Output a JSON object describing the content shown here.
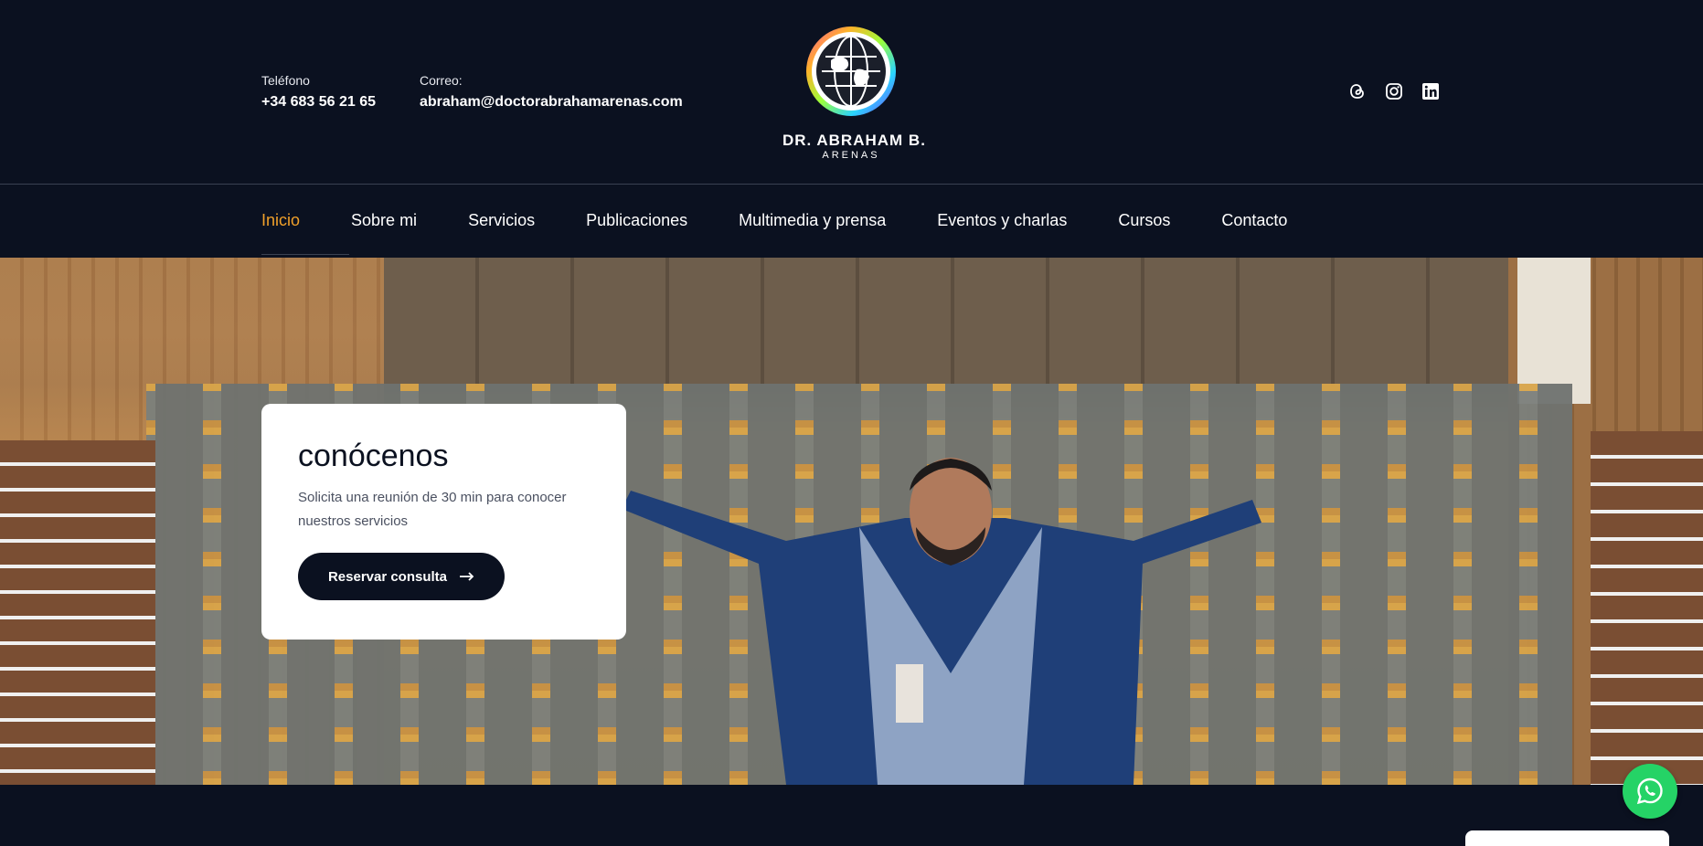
{
  "header": {
    "phone_label": "Teléfono",
    "phone_value": "+34 683 56 21 65",
    "email_label": "Correo:",
    "email_value": "abraham@doctorabrahamarenas.com",
    "logo_name": "DR. ABRAHAM B.",
    "logo_sub": "ARENAS",
    "social_icons": [
      "threads-icon",
      "instagram-icon",
      "linkedin-icon"
    ]
  },
  "nav": {
    "items": [
      "Inicio",
      "Sobre mi",
      "Servicios",
      "Publicaciones",
      "Multimedia y prensa",
      "Eventos y charlas",
      "Cursos",
      "Contacto"
    ],
    "active": "Inicio",
    "active_color": "#f0a02a"
  },
  "hero": {
    "card_title": "conócenos",
    "card_text": "Solicita una reunión de 30 min para conocer nuestros servicios",
    "button_label": "Reservar consulta",
    "button_icon": "arrow-right-icon"
  },
  "floating": {
    "whatsapp_icon": "whatsapp-icon",
    "whatsapp_color": "#25d366"
  },
  "colors": {
    "background": "#0b1120",
    "accent": "#f0a02a"
  }
}
